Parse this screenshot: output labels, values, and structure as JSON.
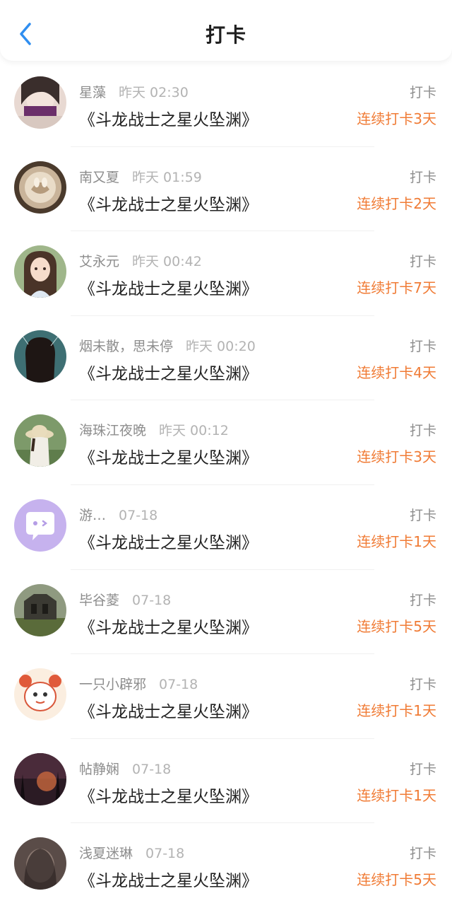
{
  "header": {
    "title": "打卡",
    "back_icon": "chevron-left-icon",
    "accent_color": "#2f8ef0"
  },
  "colors": {
    "streak": "#f07b35",
    "meta": "#8d8d8d",
    "time": "#b3b3b3"
  },
  "checkins": [
    {
      "name": "星藻",
      "time": "昨天 02:30",
      "book": "《斗龙战士之星火坠渊》",
      "action": "打卡",
      "streak": "连续打卡3天",
      "avatar": "photo-avatar"
    },
    {
      "name": "南又夏",
      "time": "昨天 01:59",
      "book": "《斗龙战士之星火坠渊》",
      "action": "打卡",
      "streak": "连续打卡2天",
      "avatar": "latte-art-avatar"
    },
    {
      "name": "艾永元",
      "time": "昨天 00:42",
      "book": "《斗龙战士之星火坠渊》",
      "action": "打卡",
      "streak": "连续打卡7天",
      "avatar": "illustrated-girl-avatar"
    },
    {
      "name": "烟未散，思未停",
      "time": "昨天 00:20",
      "book": "《斗龙战士之星火坠渊》",
      "action": "打卡",
      "streak": "连续打卡4天",
      "avatar": "dark-hair-avatar"
    },
    {
      "name": "海珠江夜晚",
      "time": "昨天 00:12",
      "book": "《斗龙战士之星火坠渊》",
      "action": "打卡",
      "streak": "连续打卡3天",
      "avatar": "straw-hat-avatar"
    },
    {
      "name": "游…",
      "time": "07-18",
      "book": "《斗龙战士之星火坠渊》",
      "action": "打卡",
      "streak": "连续打卡1天",
      "avatar": "default-chat-avatar"
    },
    {
      "name": "毕谷菱",
      "time": "07-18",
      "book": "《斗龙战士之星火坠渊》",
      "action": "打卡",
      "streak": "连续打卡5天",
      "avatar": "ruins-avatar"
    },
    {
      "name": "一只小辟邪",
      "time": "07-18",
      "book": "《斗龙战士之星火坠渊》",
      "action": "打卡",
      "streak": "连续打卡1天",
      "avatar": "cartoon-beast-avatar"
    },
    {
      "name": "帖静娴",
      "time": "07-18",
      "book": "《斗龙战士之星火坠渊》",
      "action": "打卡",
      "streak": "连续打卡1天",
      "avatar": "night-scene-avatar"
    },
    {
      "name": "浅夏迷琳",
      "time": "07-18",
      "book": "《斗龙战士之星火坠渊》",
      "action": "打卡",
      "streak": "连续打卡5天",
      "avatar": "portrait-avatar"
    }
  ]
}
